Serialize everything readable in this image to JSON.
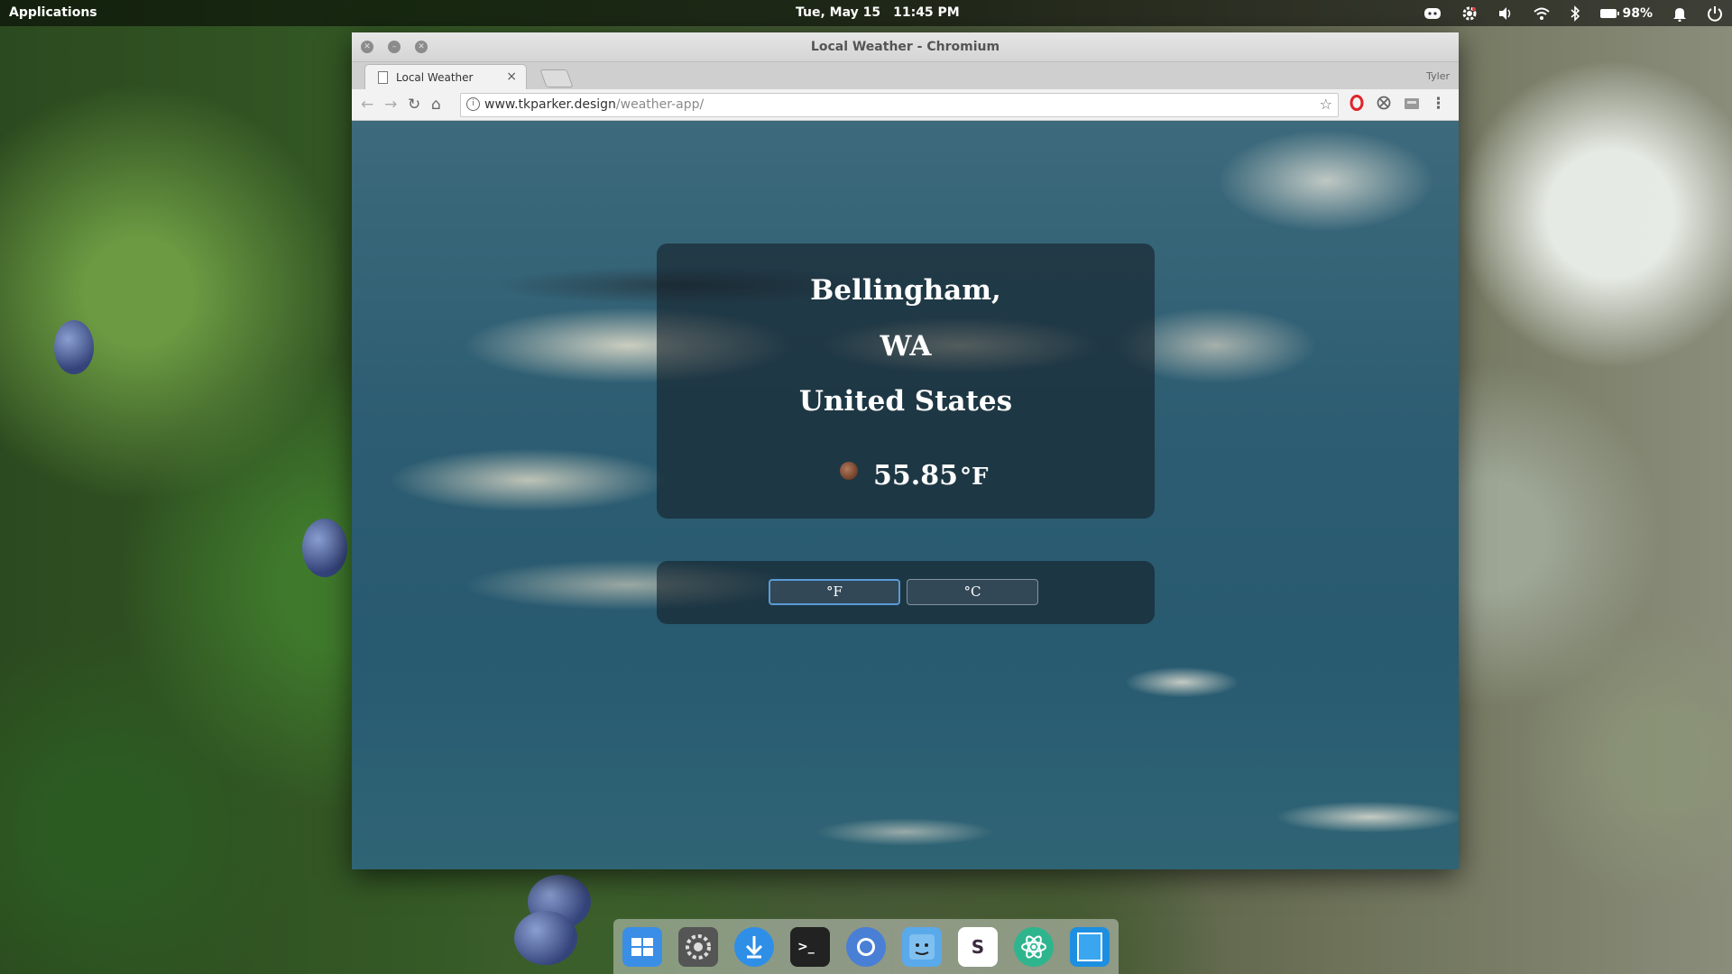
{
  "top_panel": {
    "applications_label": "Applications",
    "date": "Tue, May 15",
    "time": "11:45 PM",
    "battery_percent": "98%"
  },
  "tray_icons": [
    "discord-icon",
    "settings-gear-icon",
    "volume-icon",
    "wifi-icon",
    "bluetooth-icon",
    "battery-icon",
    "notification-bell-icon",
    "power-icon"
  ],
  "browser": {
    "window_title": "Local Weather - Chromium",
    "tab_label": "Local Weather",
    "profile_name": "Tyler",
    "url_host": "www.tkparker.design",
    "url_path": "/weather-app/"
  },
  "weather": {
    "city": "Bellingham,",
    "state": "WA",
    "country": "United States",
    "temperature": "55.85",
    "unit_symbol": "°F",
    "buttons": {
      "fahrenheit": "°F",
      "celsius": "°C"
    },
    "active_unit": "fahrenheit"
  },
  "dock_icons": [
    "multitasking-view-icon",
    "system-settings-icon",
    "appcenter-download-icon",
    "terminal-icon",
    "chromium-icon",
    "finder-icon",
    "slack-icon",
    "atom-icon",
    "notes-icon"
  ],
  "colors": {
    "active_button_border": "#5b9bd5",
    "card_bg": "rgba(20,30,38,0.6)"
  }
}
